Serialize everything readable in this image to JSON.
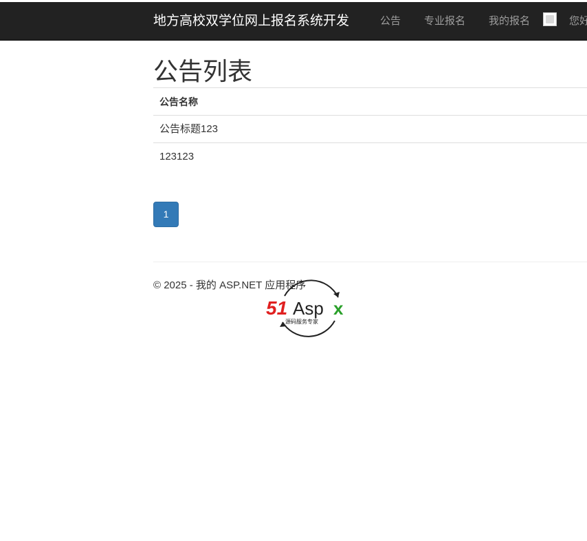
{
  "nav": {
    "brand": "地方高校双学位网上报名系统开发",
    "links": [
      "公告",
      "专业报名",
      "我的报名"
    ],
    "welcome": "您好"
  },
  "main": {
    "title": "公告列表",
    "table": {
      "header": "公告名称",
      "rows": [
        "公告标题123",
        "123123"
      ]
    },
    "pagination": {
      "current_page": "1"
    }
  },
  "footer": {
    "text": "© 2025 - 我的 ASP.NET 应用程序"
  },
  "logo": {
    "text_51": "51",
    "text_asp": "Asp",
    "text_x": "x",
    "tagline": "源码服务专家"
  },
  "colors": {
    "navbar_bg": "#222222",
    "brand": "#ffffff",
    "nav_link": "#9d9d9d",
    "pagination_active": "#337ab7",
    "logo_red": "#e02020",
    "logo_green": "#2aa02a"
  }
}
